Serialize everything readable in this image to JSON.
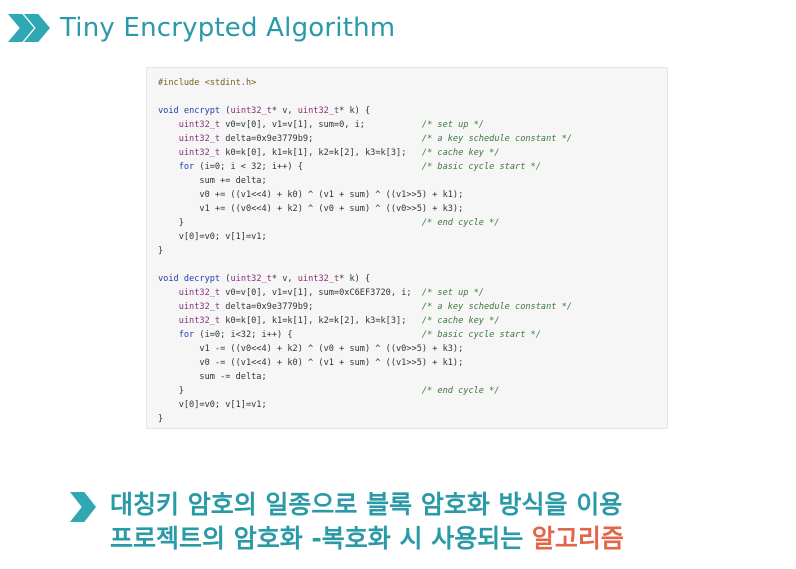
{
  "header": {
    "title": "Tiny Encrypted Algorithm",
    "icon": "double-chevron-right-icon"
  },
  "code": {
    "lines": [
      "#include <stdint.h>",
      "",
      "void encrypt (uint32_t* v, uint32_t* k) {",
      "    uint32_t v0=v[0], v1=v[1], sum=0, i;           /* set up */",
      "    uint32_t delta=0x9e3779b9;                     /* a key schedule constant */",
      "    uint32_t k0=k[0], k1=k[1], k2=k[2], k3=k[3];   /* cache key */",
      "    for (i=0; i < 32; i++) {                       /* basic cycle start */",
      "        sum += delta;",
      "        v0 += ((v1<<4) + k0) ^ (v1 + sum) ^ ((v1>>5) + k1);",
      "        v1 += ((v0<<4) + k2) ^ (v0 + sum) ^ ((v0>>5) + k3);",
      "    }                                              /* end cycle */",
      "    v[0]=v0; v[1]=v1;",
      "}",
      "",
      "void decrypt (uint32_t* v, uint32_t* k) {",
      "    uint32_t v0=v[0], v1=v[1], sum=0xC6EF3720, i;  /* set up */",
      "    uint32_t delta=0x9e3779b9;                     /* a key schedule constant */",
      "    uint32_t k0=k[0], k1=k[1], k2=k[2], k3=k[3];   /* cache key */",
      "    for (i=0; i<32; i++) {                         /* basic cycle start */",
      "        v1 -= ((v0<<4) + k2) ^ (v0 + sum) ^ ((v0>>5) + k3);",
      "        v0 -= ((v1<<4) + k0) ^ (v1 + sum) ^ ((v1>>5) + k1);",
      "        sum -= delta;",
      "    }                                              /* end cycle */",
      "    v[0]=v0; v[1]=v1;",
      "}"
    ]
  },
  "bullet": {
    "icon": "chevron-right-icon",
    "line1": "대칭키 암호의 일종으로 블록 암호화 방식을 이용",
    "line2_main": "프로젝트의 암호화 -복호화 시  사용되는 ",
    "line2_accent": "알고리즘"
  },
  "colors": {
    "accent_teal": "#2a9aa6",
    "accent_orange": "#e2674a"
  }
}
